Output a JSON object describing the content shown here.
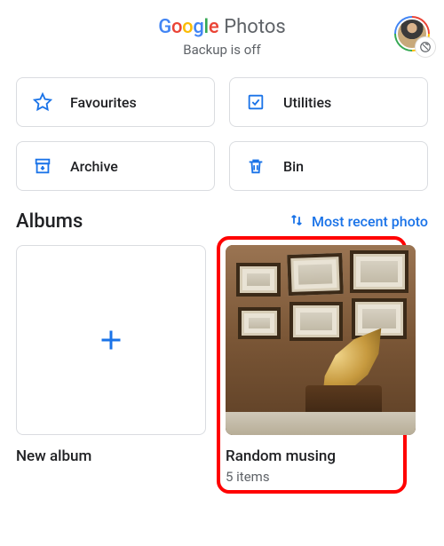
{
  "header": {
    "app_name_google": "Google",
    "app_name_photos": "Photos",
    "backup_status": "Backup is off"
  },
  "tools": {
    "favourites": "Favourites",
    "utilities": "Utilities",
    "archive": "Archive",
    "bin": "Bin"
  },
  "albums": {
    "heading": "Albums",
    "sort_label": "Most recent photo",
    "new_album_label": "New album",
    "items": [
      {
        "title": "Random musing",
        "subtitle": "5 items"
      }
    ]
  }
}
